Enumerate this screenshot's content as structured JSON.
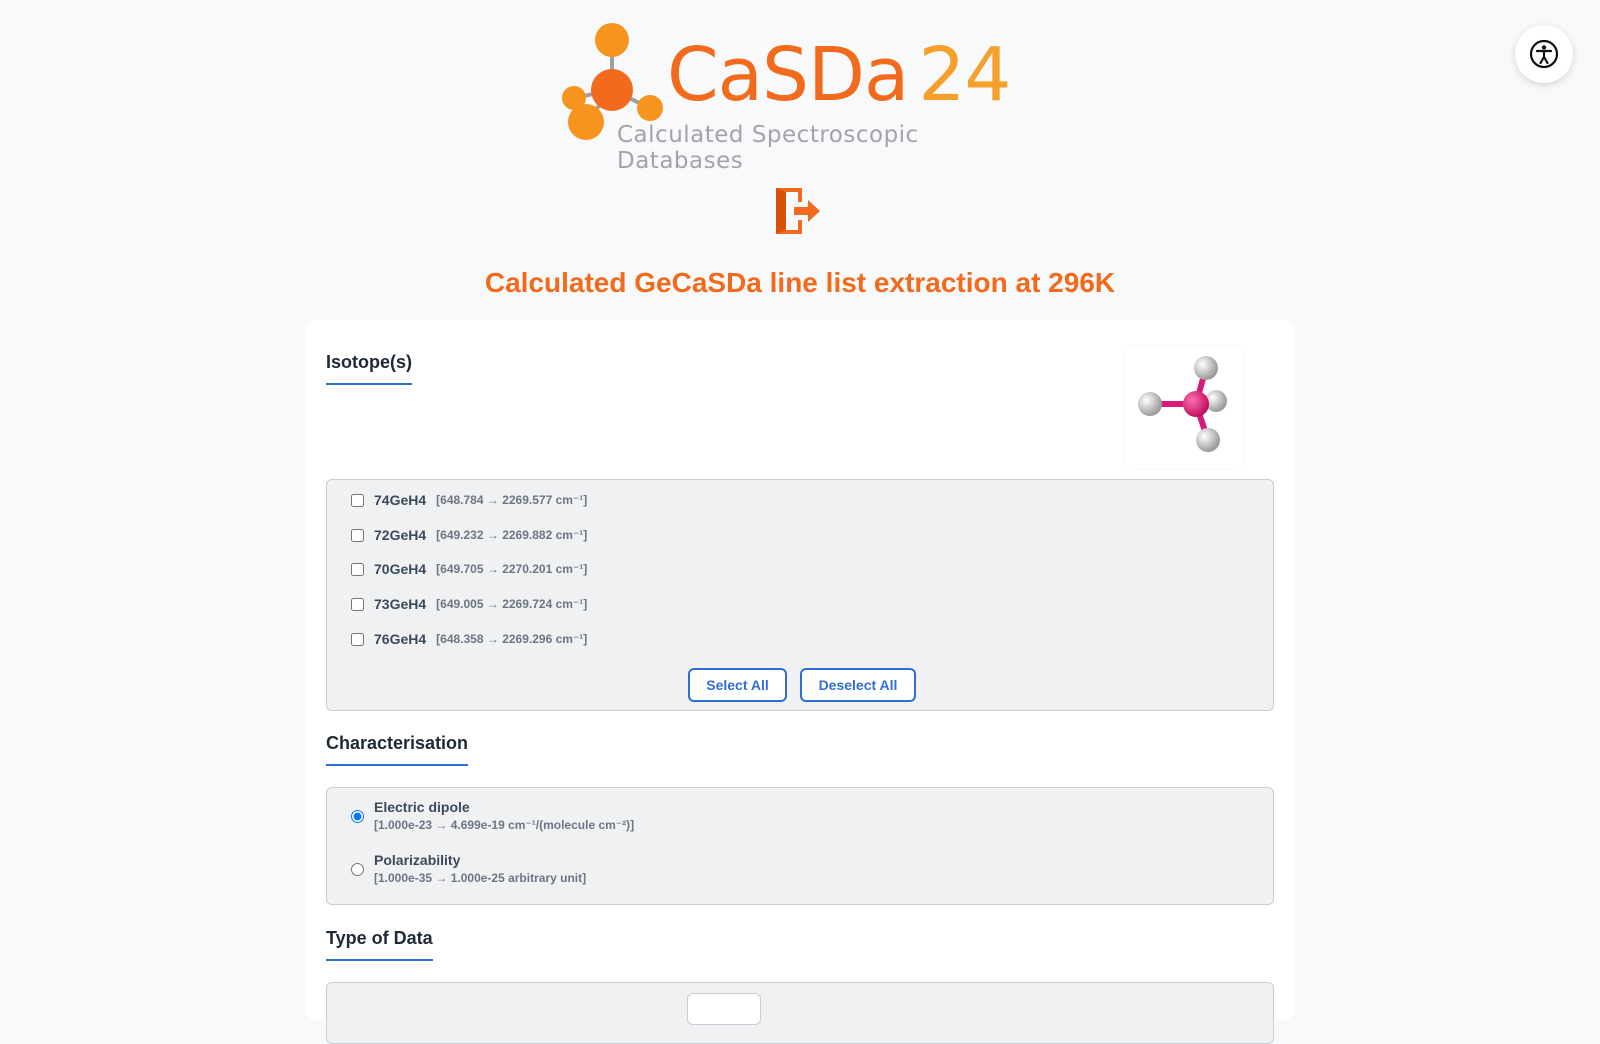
{
  "header": {
    "logo_word": "CaSDa",
    "logo_version": "24",
    "logo_subtitle": "Calculated Spectroscopic Databases",
    "exit_icon": "logout-icon",
    "accessibility_icon": "accessibility-icon"
  },
  "page_title": "Calculated GeCaSDa line list extraction at 296K",
  "isotopes": {
    "title": "Isotope(s)",
    "items": [
      {
        "name": "74GeH4",
        "range": "[648.784 → 2269.577 cm⁻¹]",
        "checked": false
      },
      {
        "name": "72GeH4",
        "range": "[649.232 → 2269.882 cm⁻¹]",
        "checked": false
      },
      {
        "name": "70GeH4",
        "range": "[649.705 → 2270.201 cm⁻¹]",
        "checked": false
      },
      {
        "name": "73GeH4",
        "range": "[649.005 → 2269.724 cm⁻¹]",
        "checked": false
      },
      {
        "name": "76GeH4",
        "range": "[648.358 → 2269.296 cm⁻¹]",
        "checked": false
      }
    ],
    "select_all": "Select All",
    "deselect_all": "Deselect All"
  },
  "characterisation": {
    "title": "Characterisation",
    "options": [
      {
        "label": "Electric dipole",
        "range": "[1.000e-23 → 4.699e-19 cm⁻¹/(molecule cm⁻²)]",
        "checked": true
      },
      {
        "label": "Polarizability",
        "range": "[1.000e-35 → 1.000e-25 arbitrary unit]",
        "checked": false
      }
    ]
  },
  "type_of_data": {
    "title": "Type of Data"
  },
  "colors": {
    "brand_orange": "#f26a1b",
    "accent_blue": "#2f6fd1",
    "molecule_center": "#d81b7a"
  }
}
